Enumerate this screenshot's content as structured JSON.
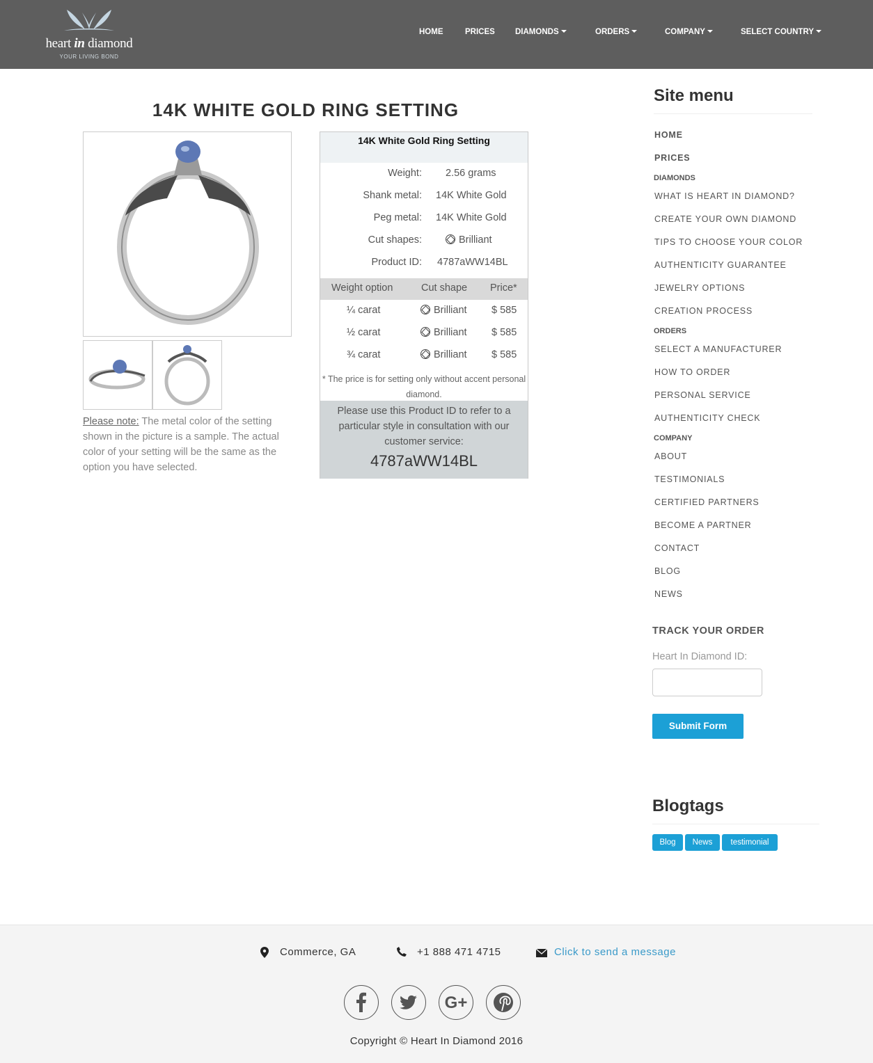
{
  "header": {
    "brand_pre": "heart",
    "brand_mid": "in",
    "brand_post": "diamond",
    "tagline": "YOUR LIVING BOND",
    "nav": [
      "HOME",
      "PRICES",
      "DIAMONDS",
      "ORDERS",
      "COMPANY",
      "SELECT COUNTRY"
    ]
  },
  "page": {
    "title": "14K WHITE GOLD RING SETTING",
    "note_label": "Please note:",
    "note_text": "The metal color of the setting shown in the picture is a sample. The actual color of your setting will be the same as the option you have selected."
  },
  "spec": {
    "heading": "14K White Gold Ring Setting",
    "weight_label": "Weight:",
    "weight_value": "2.56 grams",
    "shank_label": "Shank metal:",
    "shank_value": "14K White Gold",
    "peg_label": "Peg metal:",
    "peg_value": "14K White Gold",
    "cut_label": "Cut shapes:",
    "cut_value": "Brilliant",
    "pid_label": "Product ID:",
    "pid_value": "4787aWW14BL",
    "table_headers": [
      "Weight option",
      "Cut shape",
      "Price*"
    ],
    "rows": [
      {
        "weight": "¼ carat",
        "cut": "Brilliant",
        "price": "$ 585"
      },
      {
        "weight": "½ carat",
        "cut": "Brilliant",
        "price": "$ 585"
      },
      {
        "weight": "¾ carat",
        "cut": "Brilliant",
        "price": "$ 585"
      }
    ],
    "footnote": "* The price is for setting only without accent personal diamond.",
    "bottom_text": "Please use this Product ID to refer to a particular style in consultation with our customer service:",
    "bottom_pid": "4787aWW14BL"
  },
  "sidebar": {
    "title": "Site menu",
    "home": "HOME",
    "prices": "PRICES",
    "cat_diamonds": "DIAMONDS",
    "diamonds": [
      "WHAT IS HEART IN DIAMOND?",
      "CREATE YOUR OWN DIAMOND",
      "TIPS TO CHOOSE YOUR COLOR",
      "AUTHENTICITY GUARANTEE",
      "JEWELRY OPTIONS",
      "CREATION PROCESS"
    ],
    "cat_orders": "ORDERS",
    "orders": [
      "SELECT A MANUFACTURER",
      "HOW TO ORDER",
      "PERSONAL SERVICE",
      "AUTHENTICITY CHECK"
    ],
    "cat_company": "COMPANY",
    "company": [
      "ABOUT",
      "TESTIMONIALS",
      "CERTIFIED PARTNERS",
      "BECOME A PARTNER",
      "CONTACT",
      "BLOG",
      "NEWS"
    ],
    "track_title": "TRACK YOUR ORDER",
    "track_label": "Heart In Diamond ID:",
    "submit": "Submit Form",
    "blog_title": "Blogtags",
    "tags": [
      "Blog",
      "News",
      "testimonial"
    ]
  },
  "footer": {
    "location": "Commerce, GA",
    "phone": "+1 888 471 4715",
    "message": "Click to send a message",
    "copyright": "Copyright © Heart In Diamond 2016"
  },
  "colors": {
    "header_bg": "#5e5e5e",
    "accent": "#1ca0d6",
    "link": "#3a9ac9"
  }
}
